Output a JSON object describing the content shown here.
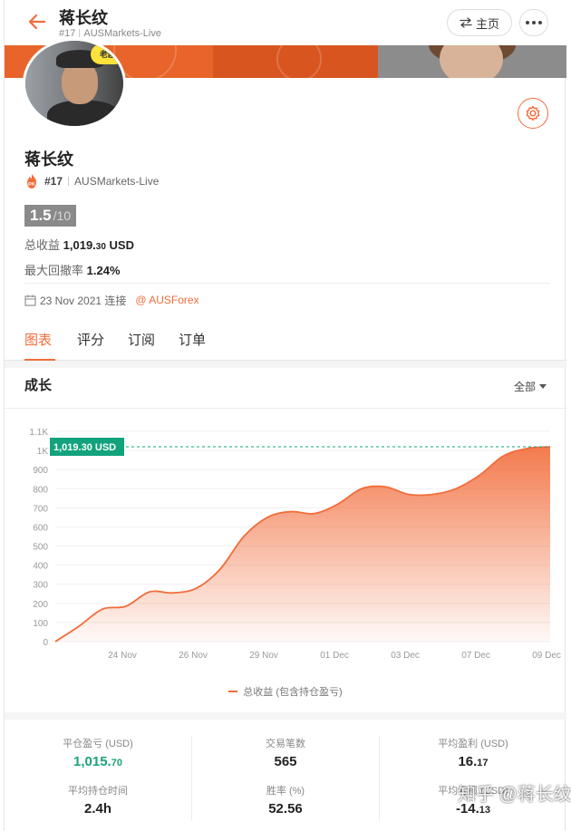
{
  "header": {
    "title": "蒋长纹",
    "rank": "#17",
    "account": "AUSMarkets-Live",
    "home_label": "主页"
  },
  "avatar": {
    "badge": "老欧"
  },
  "profile": {
    "name": "蒋长纹",
    "rank": "#17",
    "account": "AUSMarkets-Live",
    "score": "1.5",
    "score_max": "/10",
    "total_profit_label": "总收益",
    "total_profit_int": "1,019.",
    "total_profit_cents": "30",
    "total_profit_unit": "USD",
    "drawdown_label": "最大回撤率",
    "drawdown_value": "1.24%",
    "join_date": "23 Nov 2021 连接",
    "broker_link": "@ AUSForex"
  },
  "tabs": [
    {
      "label": "图表",
      "active": true
    },
    {
      "label": "评分",
      "active": false
    },
    {
      "label": "订阅",
      "active": false
    },
    {
      "label": "订单",
      "active": false
    }
  ],
  "growth": {
    "title": "成长",
    "filter_label": "全部"
  },
  "chart_data": {
    "type": "area",
    "title": "",
    "xlabel": "",
    "ylabel": "",
    "ylim": [
      0,
      1100
    ],
    "y_ticks": [
      "0",
      "100",
      "200",
      "300",
      "400",
      "500",
      "600",
      "700",
      "800",
      "900",
      "1K",
      "1.1K"
    ],
    "x_tick_labels": [
      "24 Nov",
      "26 Nov",
      "29 Nov",
      "01 Dec",
      "03 Dec",
      "07 Dec",
      "09 Dec"
    ],
    "last_value_label": "1,019.30 USD",
    "grid": true,
    "legend_position": "bottom",
    "color": "#f26c3a",
    "series": [
      {
        "name": "总收益 (包含持仓盈亏)",
        "values": [
          0,
          80,
          170,
          185,
          260,
          255,
          280,
          380,
          550,
          650,
          680,
          670,
          720,
          800,
          810,
          770,
          770,
          800,
          870,
          970,
          1010,
          1019.3
        ]
      }
    ]
  },
  "summary": {
    "closed_pl_label": "平仓盈亏 (USD)",
    "closed_pl_int": "1,015.",
    "closed_pl_cents": "70",
    "trades_label": "交易笔数",
    "trades_value": "565",
    "avg_profit_label": "平均盈利 (USD)",
    "avg_profit_int": "16.",
    "avg_profit_cents": "17",
    "avg_hold_label": "平均持仓时间",
    "avg_hold_value": "2.4h",
    "win_rate_label": "胜率 (%)",
    "win_rate_value": "52.56",
    "avg_loss_label": "平均亏损 (USD)",
    "avg_loss_int": "-14.",
    "avg_loss_cents": "13"
  },
  "watermark": "知乎 @蒋长纹",
  "colors": {
    "accent": "#f26c3a",
    "positive": "#1aa37a",
    "label_bg": "#12a37d"
  }
}
